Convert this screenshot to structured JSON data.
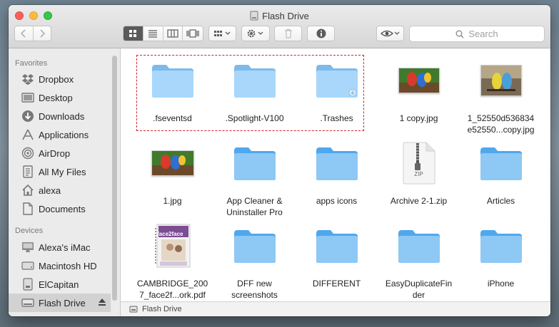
{
  "window": {
    "title": "Flash Drive"
  },
  "toolbar": {
    "back_icon": "chevron-left-icon",
    "forward_icon": "chevron-right-icon",
    "view_modes": [
      "icon-view-icon",
      "list-view-icon",
      "column-view-icon",
      "cover-flow-icon"
    ],
    "search_placeholder": "Search"
  },
  "sidebar": {
    "favorites_header": "Favorites",
    "favorites": [
      {
        "label": "Dropbox",
        "icon": "dropbox-icon"
      },
      {
        "label": "Desktop",
        "icon": "desktop-icon"
      },
      {
        "label": "Downloads",
        "icon": "downloads-icon"
      },
      {
        "label": "Applications",
        "icon": "applications-icon"
      },
      {
        "label": "AirDrop",
        "icon": "airdrop-icon"
      },
      {
        "label": "All My Files",
        "icon": "all-files-icon"
      },
      {
        "label": "alexa",
        "icon": "home-icon"
      },
      {
        "label": "Documents",
        "icon": "documents-icon"
      }
    ],
    "devices_header": "Devices",
    "devices": [
      {
        "label": "Alexa's iMac",
        "icon": "imac-icon"
      },
      {
        "label": "Macintosh HD",
        "icon": "hard-disk-icon"
      },
      {
        "label": "ElCapitan",
        "icon": "disk-icon"
      },
      {
        "label": "Flash Drive",
        "icon": "drive-icon",
        "selected": true
      }
    ]
  },
  "files": [
    {
      "name": ".fseventsd",
      "kind": "folder"
    },
    {
      "name": ".Spotlight-V100",
      "kind": "folder"
    },
    {
      "name": ".Trashes",
      "kind": "folder"
    },
    {
      "name": "1 copy.jpg",
      "kind": "image"
    },
    {
      "name": "1_52550d536834\ne52550...copy.jpg",
      "kind": "image"
    },
    {
      "name": "1.jpg",
      "kind": "image"
    },
    {
      "name": "App Cleaner &\nUninstaller Pro",
      "kind": "folder"
    },
    {
      "name": "apps icons",
      "kind": "folder"
    },
    {
      "name": "Archive 2-1.zip",
      "kind": "zip"
    },
    {
      "name": "Articles",
      "kind": "folder"
    },
    {
      "name": "CAMBRIDGE_200\n7_face2f...ork.pdf",
      "kind": "pdf"
    },
    {
      "name": "DFF new\nscreenshots",
      "kind": "folder"
    },
    {
      "name": "DIFFERENT",
      "kind": "folder"
    },
    {
      "name": "EasyDuplicateFin\nder",
      "kind": "folder"
    },
    {
      "name": "iPhone",
      "kind": "folder"
    }
  ],
  "zip_badge": "ZIP",
  "pdf_cover_text": "face2face",
  "statusbar": {
    "path": "Flash Drive"
  },
  "colors": {
    "folder": "#8ec8f4",
    "highlight": "#d1242b",
    "selected_row": "#d2d2d2"
  }
}
